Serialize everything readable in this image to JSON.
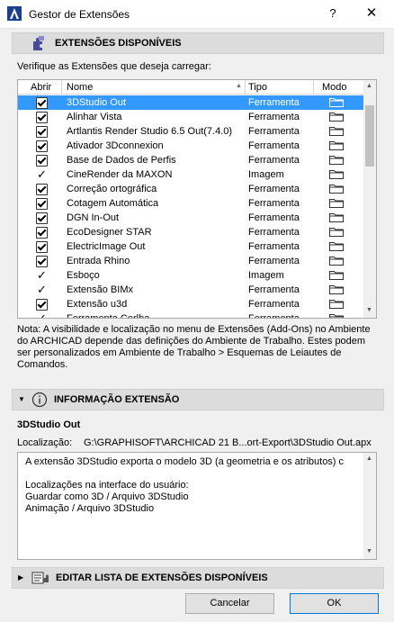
{
  "window": {
    "title": "Gestor de Extensões",
    "help": "?",
    "close": "✕"
  },
  "available": {
    "header": "EXTENSÕES DISPONÍVEIS",
    "instruction": "Verifique as Extensões que deseja carregar:",
    "columns": {
      "load": "Abrir",
      "name": "Nome",
      "type": "Tipo",
      "mode": "Modo"
    },
    "rows": [
      {
        "name": "3DStudio Out",
        "type": "Ferramenta",
        "mark": "check",
        "selected": true
      },
      {
        "name": "Alinhar Vista",
        "type": "Ferramenta",
        "mark": "check"
      },
      {
        "name": "Artlantis Render Studio 6.5 Out(7.4.0)",
        "type": "Ferramenta",
        "mark": "check"
      },
      {
        "name": "Ativador 3Dconnexion",
        "type": "Ferramenta",
        "mark": "check"
      },
      {
        "name": "Base de Dados de Perfis",
        "type": "Ferramenta",
        "mark": "check"
      },
      {
        "name": "CineRender da MAXON",
        "type": "Imagem",
        "mark": "tick"
      },
      {
        "name": "Correção ortográfica",
        "type": "Ferramenta",
        "mark": "check"
      },
      {
        "name": "Cotagem Automática",
        "type": "Ferramenta",
        "mark": "check"
      },
      {
        "name": "DGN In-Out",
        "type": "Ferramenta",
        "mark": "check"
      },
      {
        "name": "EcoDesigner STAR",
        "type": "Ferramenta",
        "mark": "check"
      },
      {
        "name": "ElectricImage Out",
        "type": "Ferramenta",
        "mark": "check"
      },
      {
        "name": "Entrada Rhino",
        "type": "Ferramenta",
        "mark": "check"
      },
      {
        "name": "Esboço",
        "type": "Imagem",
        "mark": "tick"
      },
      {
        "name": "Extensão BIMx",
        "type": "Ferramenta",
        "mark": "tick"
      },
      {
        "name": "Extensão u3d",
        "type": "Ferramenta",
        "mark": "check"
      },
      {
        "name": "Ferramenta Cerlha",
        "type": "Ferramenta",
        "mark": "tick"
      }
    ],
    "note": "Nota: A visibilidade e localização no menu de Extensões (Add-Ons) no Ambiente do ARCHICAD depende das definições do Ambiente de Trabalho. Estes podem ser personalizados em Ambiente de Trabalho > Esquemas de Leiautes de Comandos."
  },
  "info": {
    "header": "INFORMAÇÃO EXTENSÃO",
    "name": "3DStudio Out",
    "location_label": "Localização:",
    "location_value": "G:\\GRAPHISOFT\\ARCHICAD 21 B...ort-Export\\3DStudio Out.apx",
    "description": "A extensão 3DStudio exporta o modelo 3D (a geometria e os atributos) c\n\nLocalizações na interface do usuário:\nGuardar como 3D / Arquivo 3DStudio\nAnimação / Arquivo 3DStudio"
  },
  "edit": {
    "header": "EDITAR LISTA DE EXTENSÕES DISPONÍVEIS"
  },
  "buttons": {
    "cancel": "Cancelar",
    "ok": "OK"
  },
  "colors": {
    "selection": "#3399ff",
    "section_bg": "#dcdcdc",
    "ok_border": "#0078d7"
  },
  "icons": {
    "app": "archicad-logo-icon",
    "extensions": "puzzle-icon",
    "info": "info-icon",
    "edit": "edit-list-icon",
    "mode": "folder-icon"
  }
}
